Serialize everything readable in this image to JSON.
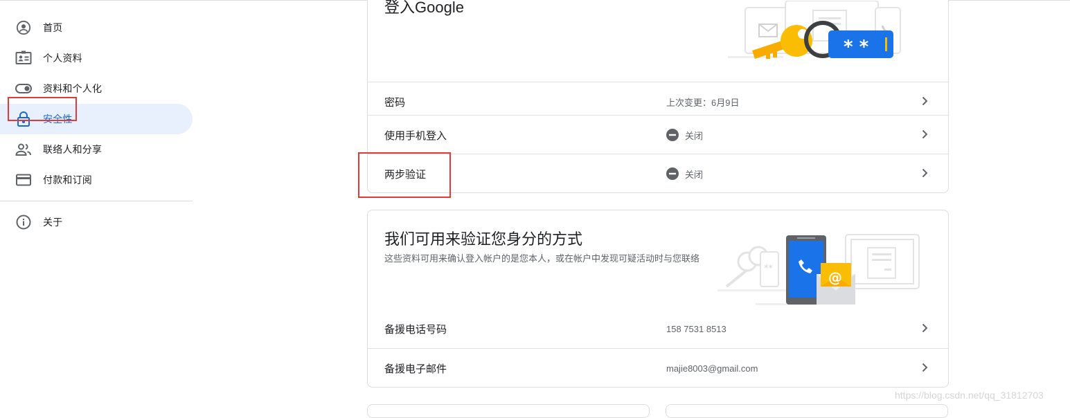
{
  "sidebar": {
    "items": [
      {
        "label": "首页",
        "icon": "account-circle-icon"
      },
      {
        "label": "个人资料",
        "icon": "id-card-icon"
      },
      {
        "label": "资料和个人化",
        "icon": "toggle-icon"
      },
      {
        "label": "安全性",
        "icon": "lock-icon",
        "active": true
      },
      {
        "label": "联络人和分享",
        "icon": "people-icon"
      },
      {
        "label": "付款和订阅",
        "icon": "credit-card-icon"
      }
    ],
    "about": {
      "label": "关于",
      "icon": "info-icon"
    }
  },
  "signin_card": {
    "title": "登入Google",
    "rows": [
      {
        "label": "密码",
        "value": "上次变更：6月9日"
      },
      {
        "label": "使用手机登入",
        "value": "关闭",
        "status_icon": "off-circle-icon"
      },
      {
        "label": "两步验证",
        "value": "关闭",
        "status_icon": "off-circle-icon"
      }
    ]
  },
  "verify_card": {
    "title": "我们可用来验证您身分的方式",
    "description": "这些资料可用来确认登入帐户的是您本人，或在帐户中发现可疑活动时与您联络",
    "rows": [
      {
        "label": "备援电话号码",
        "value": "158 7531 8513"
      },
      {
        "label": "备援电子邮件",
        "value": "majie8003@gmail.com"
      }
    ]
  },
  "watermark": "https://blog.csdn.net/qq_31812703",
  "colors": {
    "active_bg": "#e8f0fe",
    "active_fg": "#1967d2",
    "annotation": "#e53935",
    "google_blue": "#1a73e8",
    "key_yellow": "#fbbc04"
  }
}
